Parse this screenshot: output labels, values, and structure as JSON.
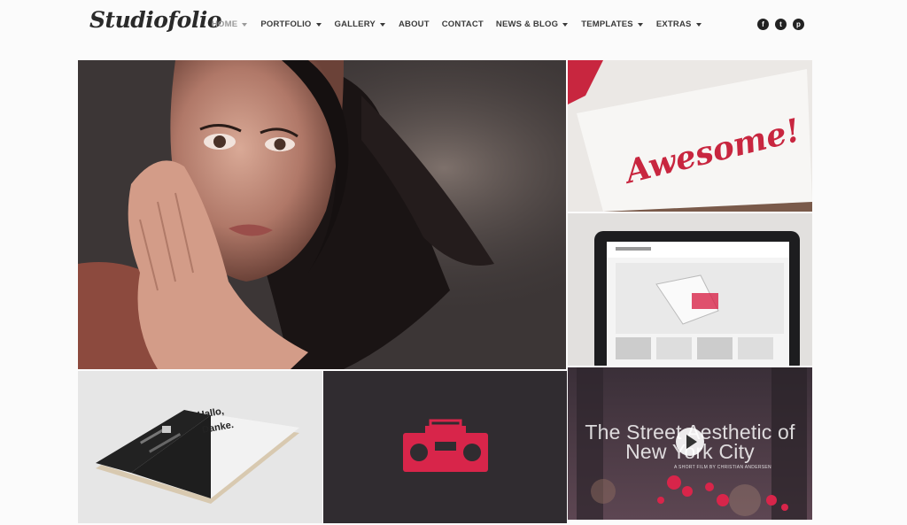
{
  "brand": {
    "logo_text": "Studiofolio"
  },
  "nav": {
    "items": [
      {
        "label": "HOME",
        "has_dropdown": true,
        "active": true
      },
      {
        "label": "PORTFOLIO",
        "has_dropdown": true,
        "active": false
      },
      {
        "label": "GALLERY",
        "has_dropdown": true,
        "active": false
      },
      {
        "label": "ABOUT",
        "has_dropdown": false,
        "active": false
      },
      {
        "label": "CONTACT",
        "has_dropdown": false,
        "active": false
      },
      {
        "label": "NEWS & BLOG",
        "has_dropdown": true,
        "active": false
      },
      {
        "label": "TEMPLATES",
        "has_dropdown": true,
        "active": false
      },
      {
        "label": "EXTRAS",
        "has_dropdown": true,
        "active": false
      }
    ]
  },
  "social": {
    "icons": [
      "facebook-icon",
      "twitter-icon",
      "pinterest-icon"
    ],
    "glyphs": [
      "f",
      "t",
      "p"
    ]
  },
  "tiles": {
    "awesome": {
      "text": "Awesome!"
    },
    "card": {
      "hello": "Hallo,",
      "danke": "Danke."
    },
    "video": {
      "title": "The Street Aesthetic of New York City",
      "subtitle": "A SHORT FILM BY CHRISTIAN ANDERSEN"
    }
  },
  "colors": {
    "accent": "#d8254a",
    "nav_active": "#9a9a9a",
    "text_dark": "#2a2a2a"
  }
}
